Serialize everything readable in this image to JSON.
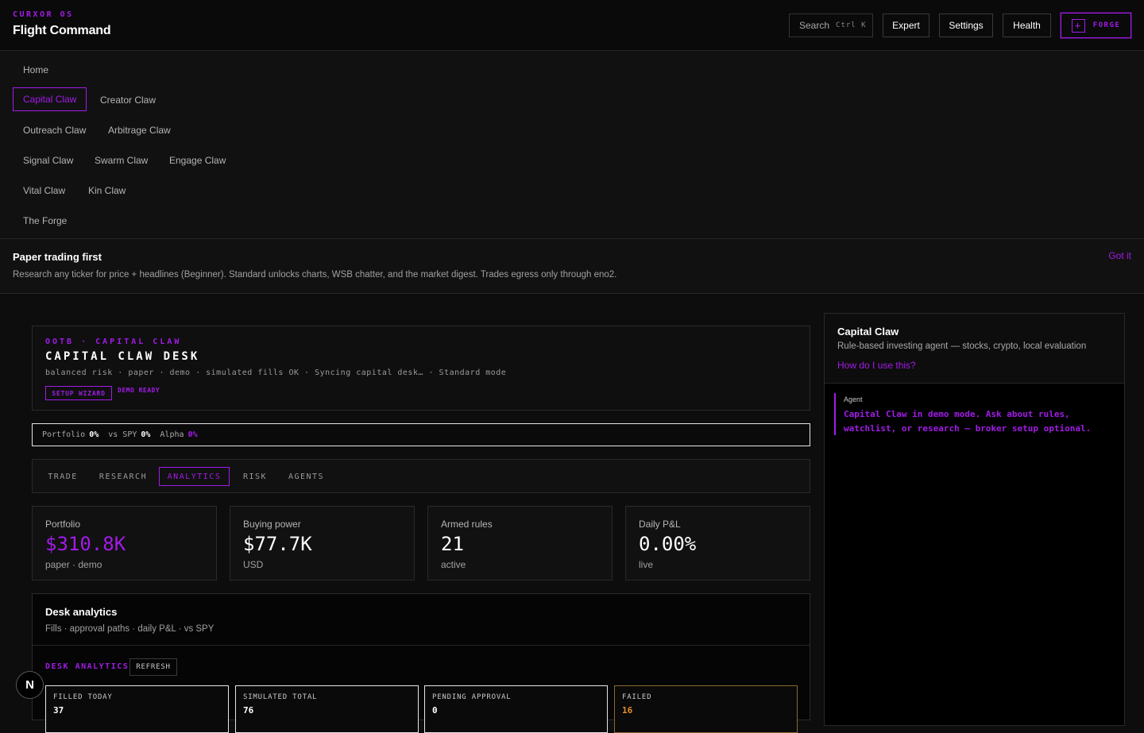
{
  "header": {
    "brand_os": "CURXOR OS",
    "title": "Flight Command",
    "search_label": "Search",
    "search_kbd": "Ctrl K",
    "buttons": {
      "expert": "Expert",
      "settings": "Settings",
      "health": "Health",
      "forge": "FORGE"
    }
  },
  "nav": {
    "items": [
      {
        "label": "Home"
      },
      {
        "label": "Capital Claw",
        "active": true
      },
      {
        "label": "Creator Claw"
      },
      {
        "label": "Outreach Claw"
      },
      {
        "label": "Arbitrage Claw"
      },
      {
        "label": "Signal Claw"
      },
      {
        "label": "Swarm Claw"
      },
      {
        "label": "Engage Claw"
      },
      {
        "label": "Vital Claw"
      },
      {
        "label": "Kin Claw"
      },
      {
        "label": "The Forge"
      }
    ]
  },
  "banner": {
    "title": "Paper trading first",
    "text": "Research any ticker for price + headlines (Beginner). Standard unlocks charts, WSB chatter, and the market digest. Trades egress only through eno2.",
    "dismiss": "Got it"
  },
  "desk": {
    "kicker": "OOTB · CAPITAL CLAW",
    "title": "CAPITAL CLAW DESK",
    "meta": "balanced risk · paper · demo · simulated fills OK · Syncing capital desk… · Standard mode",
    "setup_button": "SETUP WIZARD",
    "status": "DEMO READY"
  },
  "performance": {
    "portfolio_label": "Portfolio",
    "portfolio_value": "0%",
    "spy_label": "vs SPY",
    "spy_value": "0%",
    "alpha_label": "Alpha",
    "alpha_value": "0%"
  },
  "tabs": [
    {
      "label": "TRADE"
    },
    {
      "label": "RESEARCH"
    },
    {
      "label": "ANALYTICS",
      "active": true
    },
    {
      "label": "RISK"
    },
    {
      "label": "AGENTS"
    }
  ],
  "stats": [
    {
      "label": "Portfolio",
      "value": "$310.8K",
      "sub": "paper · demo"
    },
    {
      "label": "Buying power",
      "value": "$77.7K",
      "sub": "USD"
    },
    {
      "label": "Armed rules",
      "value": "21",
      "sub": "active"
    },
    {
      "label": "Daily P&L",
      "value": "0.00%",
      "sub": "live"
    }
  ],
  "analytics": {
    "title": "Desk analytics",
    "subtitle": "Fills · approval paths · daily P&L · vs SPY",
    "label": "DESK ANALYTICS",
    "refresh": "REFRESH",
    "metrics": [
      {
        "label": "FILLED TODAY",
        "value": "37"
      },
      {
        "label": "SIMULATED TOTAL",
        "value": "76"
      },
      {
        "label": "PENDING APPROVAL",
        "value": "0"
      },
      {
        "label": "FAILED",
        "value": "16"
      }
    ]
  },
  "side": {
    "title": "Capital Claw",
    "subtitle": "Rule-based investing agent — stocks, crypto, local evaluation",
    "help_link": "How do I use this?",
    "agent_label": "Agent",
    "agent_message": "Capital Claw in demo mode. Ask about rules, watchlist, or research — broker setup optional."
  },
  "badge": "N",
  "colors": {
    "accent": "#a21be8",
    "warning": "#e0902a",
    "background": "#0d0d0d"
  }
}
